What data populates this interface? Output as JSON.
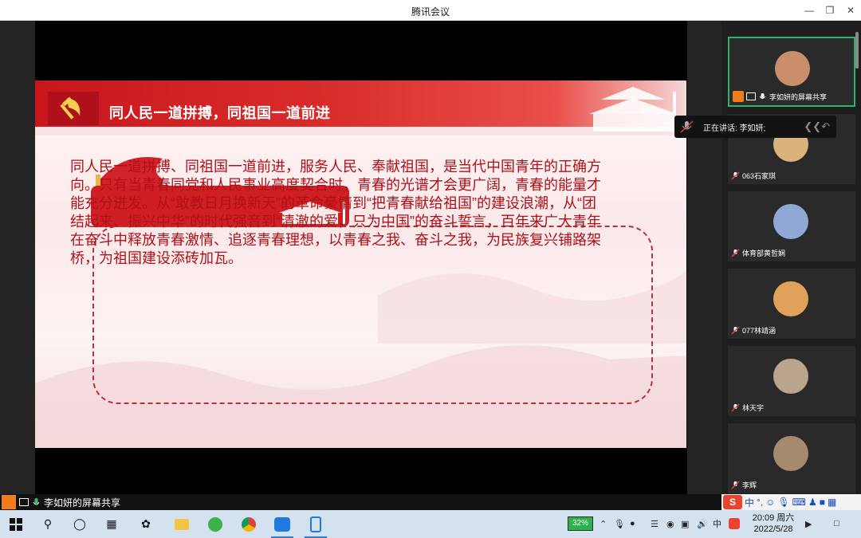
{
  "window": {
    "title": "腾讯会议"
  },
  "slide": {
    "heading": "同人民一道拼搏，同祖国一道前进",
    "body": "同人民一道拼搏、同祖国一道前进，服务人民、奉献祖国，是当代中国青年的正确方向。只有当青春同党和人民事业高度契合时，青春的光谱才会更广阔，青春的能量才能充分迸发。从“敢教日月换新天”的革命豪情到“把青春献给祖国”的建设浪潮，从“团结起来、振兴中华”的时代强音到“清澈的爱，只为中国”的奋斗誓言，百年来广大青年在奋斗中释放青春激情、追逐青春理想，以青春之我、奋斗之我，为民族复兴铺路架桥，为祖国建设添砖加瓦。"
  },
  "speaking": {
    "label": "正在讲话: 李如妍;"
  },
  "participants": [
    {
      "name": "李如妍的屏幕共享",
      "avatar_color": "#c98f6b"
    },
    {
      "name": "063石家琪",
      "avatar_color": "#d9b27c"
    },
    {
      "name": "体育部黄哲娴",
      "avatar_color": "#8fa8d6"
    },
    {
      "name": "077林靖涵",
      "avatar_color": "#e0a15a"
    },
    {
      "name": "林天宇",
      "avatar_color": "#b9a58c"
    },
    {
      "name": "李辉",
      "avatar_color": "#a58a6d"
    }
  ],
  "sharebar": {
    "label": "李如妍的屏幕共享"
  },
  "ime": {
    "lang": "中",
    "punct": "°,"
  },
  "tray": {
    "battery": "32%",
    "lang": "中",
    "time": "20:09 周六",
    "date": "2022/5/28"
  }
}
